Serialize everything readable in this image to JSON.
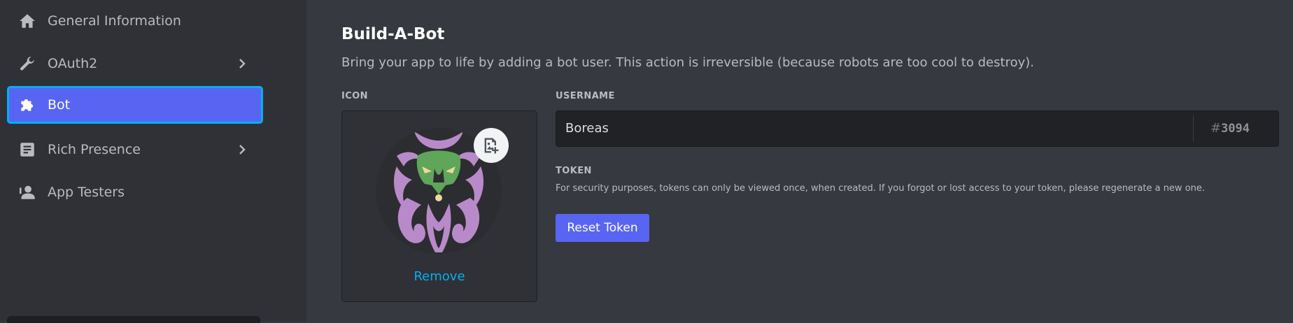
{
  "sidebar": {
    "items": [
      {
        "label": "General Information",
        "icon": "home-icon",
        "has_chevron": false
      },
      {
        "label": "OAuth2",
        "icon": "wrench-icon",
        "has_chevron": true
      },
      {
        "label": "Bot",
        "icon": "puzzle-icon",
        "has_chevron": false,
        "active": true
      },
      {
        "label": "Rich Presence",
        "icon": "document-icon",
        "has_chevron": true
      },
      {
        "label": "App Testers",
        "icon": "person-icon",
        "has_chevron": false
      }
    ]
  },
  "main": {
    "title": "Build-A-Bot",
    "subtitle": "Bring your app to life by adding a bot user. This action is irreversible (because robots are too cool to destroy).",
    "icon_section": {
      "label": "ICON",
      "remove_label": "Remove",
      "upload_icon": "image-plus-icon"
    },
    "username_section": {
      "label": "USERNAME",
      "value": "Boreas",
      "discriminator_hash": "#",
      "discriminator": "3094"
    },
    "token_section": {
      "label": "TOKEN",
      "description": "For security purposes, tokens can only be viewed once, when created. If you forgot or lost access to your token, please regenerate a new one.",
      "reset_button": "Reset Token"
    }
  },
  "colors": {
    "background": "#36393f",
    "sidebar": "#2f3136",
    "accent": "#5865f2",
    "focus_ring": "#00b0f4",
    "link": "#00aff4",
    "avatar_green": "#5fa55a",
    "avatar_purple": "#b98ac9"
  }
}
